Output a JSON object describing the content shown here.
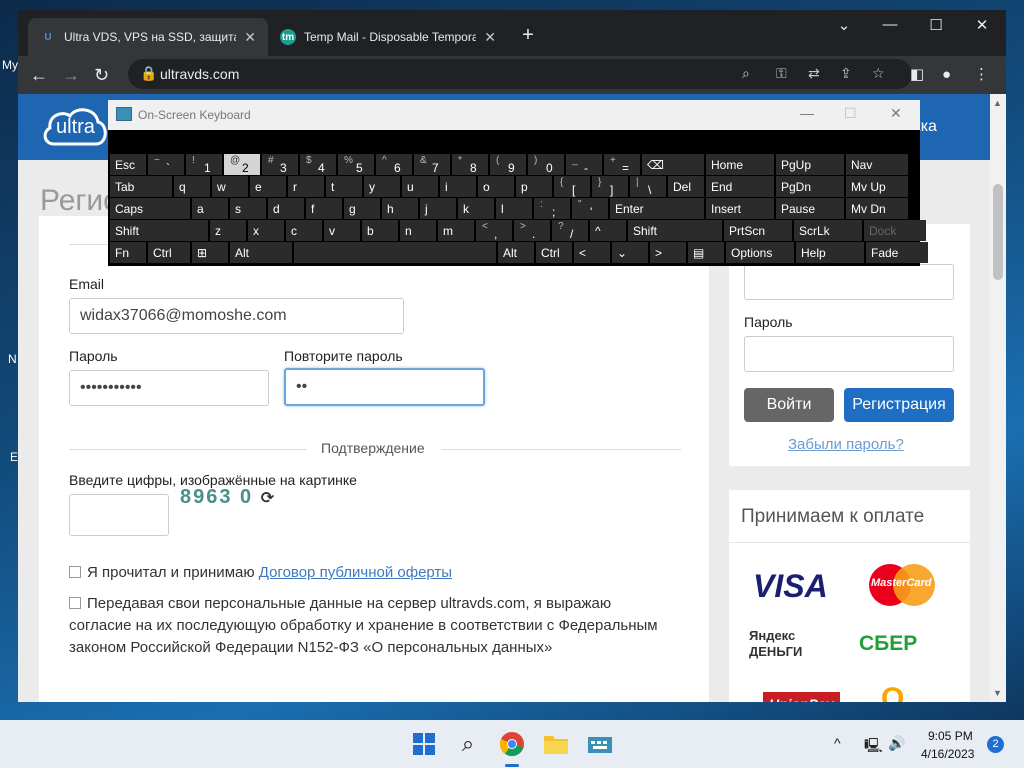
{
  "desktop": {
    "icon_labels": [
      "My",
      "N",
      "E"
    ]
  },
  "browser": {
    "tabs": [
      {
        "title": "Ultra VDS, VPS на SSD, защита о",
        "favicon": "U"
      },
      {
        "title": "Temp Mail - Disposable Tempora",
        "favicon": "tm"
      }
    ],
    "new_tab": "+",
    "window_controls": {
      "dropdown": "⌄",
      "minimize": "—",
      "maximize": "☐",
      "close": "✕"
    },
    "url": "ultravds.com"
  },
  "site": {
    "logo": "ultra",
    "header_link": "жка",
    "heading": "Регис",
    "form": {
      "email_label": "Email",
      "email_value": "widax37066@momoshe.com",
      "password_label": "Пароль",
      "password_value": "•••••••••••",
      "repeat_label": "Повторите пароль",
      "repeat_value": "••",
      "confirm_title": "Подтверждение",
      "captcha_label": "Введите цифры, изображённые на картинке",
      "captcha_text": "8963 0",
      "captcha_refresh_icon": "refresh-icon",
      "offer_text": "Я прочитал и принимаю ",
      "offer_link": "Договор публичной оферты",
      "consent_text": "Передавая свои персональные данные на сервер ultravds.com, я выражаю согласие на их последующую обработку и хранение в соответствии с Федеральным законом Российской Федерации N152-ФЗ «О персональных данных»"
    },
    "login": {
      "password_label": "Пароль",
      "login_button": "Войти",
      "register_button": "Регистрация",
      "forgot_link": "Забыли пароль?"
    },
    "payments": {
      "title": "Принимаем к оплате",
      "logos": [
        "VISA",
        "MasterCard",
        "Яндекс ДЕНЬГИ",
        "СБЕР",
        "UnionPay",
        "Q"
      ]
    }
  },
  "keyboard": {
    "title": "On-Screen Keyboard",
    "minimize": "—",
    "maximize": "☐",
    "close": "✕",
    "rows": [
      [
        [
          "Esc",
          ""
        ],
        [
          "`",
          "~"
        ],
        [
          "1",
          "!"
        ],
        [
          "2",
          "@"
        ],
        [
          "3",
          "#"
        ],
        [
          "4",
          "$"
        ],
        [
          "5",
          "%"
        ],
        [
          "6",
          "^"
        ],
        [
          "7",
          "&"
        ],
        [
          "8",
          "*"
        ],
        [
          "9",
          "("
        ],
        [
          "0",
          ")"
        ],
        [
          "-",
          "_"
        ],
        [
          "=",
          "+"
        ],
        [
          "⌫",
          ""
        ],
        [
          "Home",
          ""
        ],
        [
          "PgUp",
          ""
        ],
        [
          "Nav",
          ""
        ]
      ],
      [
        [
          "Tab",
          ""
        ],
        [
          "q",
          ""
        ],
        [
          "w",
          ""
        ],
        [
          "e",
          ""
        ],
        [
          "r",
          ""
        ],
        [
          "t",
          ""
        ],
        [
          "y",
          ""
        ],
        [
          "u",
          ""
        ],
        [
          "i",
          ""
        ],
        [
          "o",
          ""
        ],
        [
          "p",
          ""
        ],
        [
          "[",
          "{"
        ],
        [
          "]",
          "}"
        ],
        [
          "\\",
          "|"
        ],
        [
          "Del",
          ""
        ],
        [
          "End",
          ""
        ],
        [
          "PgDn",
          ""
        ],
        [
          "Mv Up",
          ""
        ]
      ],
      [
        [
          "Caps",
          ""
        ],
        [
          "a",
          ""
        ],
        [
          "s",
          ""
        ],
        [
          "d",
          ""
        ],
        [
          "f",
          ""
        ],
        [
          "g",
          ""
        ],
        [
          "h",
          ""
        ],
        [
          "j",
          ""
        ],
        [
          "k",
          ""
        ],
        [
          "l",
          ""
        ],
        [
          ";",
          ":"
        ],
        [
          "'",
          "\""
        ],
        [
          "Enter",
          ""
        ],
        [
          "Insert",
          ""
        ],
        [
          "Pause",
          ""
        ],
        [
          "Mv Dn",
          ""
        ]
      ],
      [
        [
          "Shift",
          ""
        ],
        [
          "z",
          ""
        ],
        [
          "x",
          ""
        ],
        [
          "c",
          ""
        ],
        [
          "v",
          ""
        ],
        [
          "b",
          ""
        ],
        [
          "n",
          ""
        ],
        [
          "m",
          ""
        ],
        [
          ",",
          "<"
        ],
        [
          ".",
          ">"
        ],
        [
          "/",
          "?"
        ],
        [
          "^",
          ""
        ],
        [
          "Shift",
          ""
        ],
        [
          "PrtScn",
          ""
        ],
        [
          "ScrLk",
          ""
        ],
        [
          "Dock",
          ""
        ]
      ],
      [
        [
          "Fn",
          ""
        ],
        [
          "Ctrl",
          ""
        ],
        [
          "⊞",
          ""
        ],
        [
          "Alt",
          ""
        ],
        [
          "",
          ""
        ],
        [
          "Alt",
          ""
        ],
        [
          "Ctrl",
          ""
        ],
        [
          "<",
          ""
        ],
        [
          "⌄",
          ""
        ],
        [
          ">",
          ""
        ],
        [
          "▤",
          ""
        ],
        [
          "Options",
          ""
        ],
        [
          "Help",
          ""
        ],
        [
          "Fade",
          ""
        ]
      ]
    ]
  },
  "taskbar": {
    "time": "9:05 PM",
    "date": "4/16/2023",
    "notifications": "2",
    "tray_chevron": "^"
  },
  "colors": {
    "brand_blue": "#1e66b1",
    "button_blue": "#1e6fc4",
    "button_gray": "#666666"
  }
}
